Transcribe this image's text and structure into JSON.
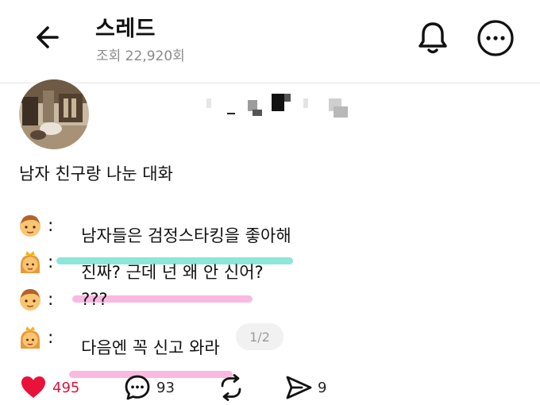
{
  "header": {
    "title": "스레드",
    "views": "조회 22,920회"
  },
  "post": {
    "text": "남자 친구랑 나눈 대화",
    "lines": [
      {
        "speaker": "boy",
        "text": "남자들은 검정스타킹을 좋아해",
        "highlight": "#6fe0cf"
      },
      {
        "speaker": "princess",
        "text": "진짜? 근데 넌 왜 안 신어?",
        "highlight": "#f7a8d8"
      },
      {
        "speaker": "boy",
        "text": "???",
        "highlight": null
      },
      {
        "speaker": "princess",
        "text": "다음엔 꼭 신고 와라",
        "highlight": "#f7a8d8"
      }
    ],
    "colon": ":",
    "page_indicator": "1/2"
  },
  "actions": {
    "likes": "495",
    "comments": "93",
    "shares": "9"
  },
  "colors": {
    "like": "#e8123a",
    "muted": "#8a8a8a"
  },
  "icons": [
    "back-arrow-icon",
    "bell-icon",
    "more-icon",
    "heart-icon",
    "comment-icon",
    "repost-icon",
    "send-icon",
    "boy-emoji-icon",
    "princess-emoji-icon"
  ]
}
